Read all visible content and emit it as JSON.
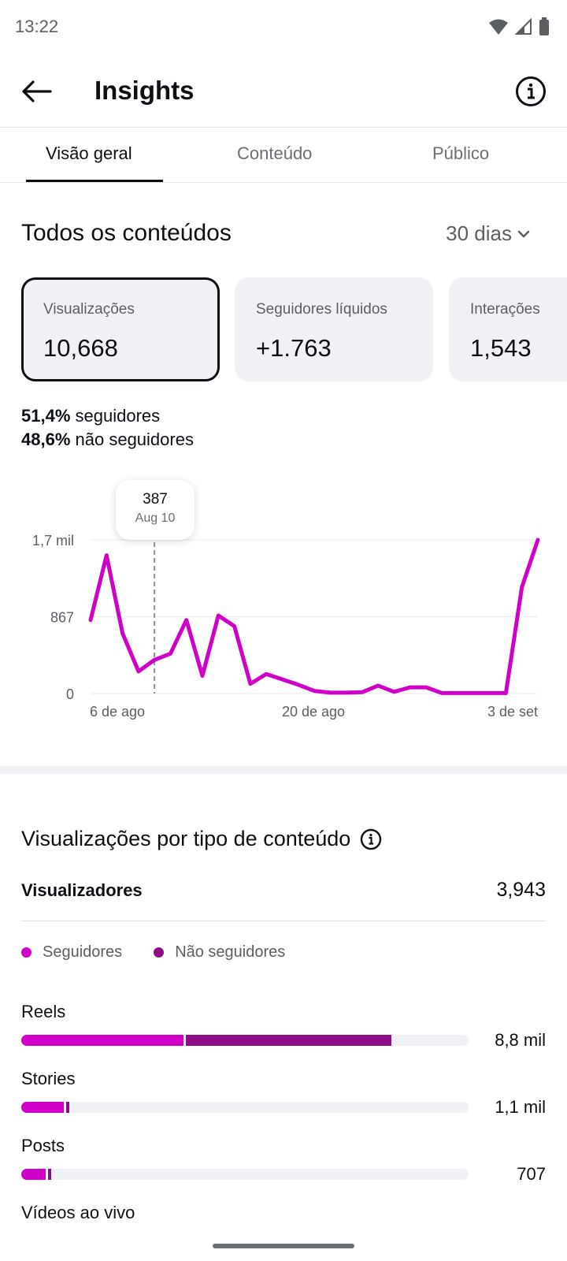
{
  "status_bar": {
    "time": "13:22"
  },
  "header": {
    "title": "Insights"
  },
  "tabs": [
    {
      "label": "Visão geral",
      "active": true
    },
    {
      "label": "Conteúdo",
      "active": false
    },
    {
      "label": "Público",
      "active": false
    }
  ],
  "section": {
    "title": "Todos os conteúdos",
    "range": "30 dias"
  },
  "metrics": [
    {
      "label": "Visualizações",
      "value": "10,668",
      "selected": true
    },
    {
      "label": "Seguidores líquidos",
      "value": "+1.763",
      "selected": false
    },
    {
      "label": "Interações",
      "value": "1,543",
      "selected": false
    }
  ],
  "ratio": {
    "followers_pct": "51,4%",
    "followers_text": "seguidores",
    "non_followers_pct": "48,6%",
    "non_followers_text": "não seguidores"
  },
  "tooltip": {
    "value": "387",
    "date": "Aug 10"
  },
  "chart_data": {
    "type": "line",
    "x_ticks": [
      "6 de ago",
      "20 de ago",
      "3 de set"
    ],
    "y_ticks": [
      "0",
      "867",
      "1,7 mil"
    ],
    "ylim": [
      0,
      1734
    ],
    "values": [
      830,
      1560,
      680,
      250,
      380,
      450,
      830,
      200,
      880,
      760,
      110,
      220,
      160,
      100,
      30,
      10,
      10,
      15,
      90,
      20,
      70,
      70,
      5,
      5,
      5,
      5,
      5,
      1200,
      1734
    ],
    "highlight_index": 4,
    "color": "#d100c9",
    "grid": true
  },
  "views_by_type": {
    "title": "Visualizações por tipo de conteúdo",
    "viewers_label": "Visualizadores",
    "viewers_value": "3,943",
    "legend": [
      {
        "label": "Seguidores",
        "color": "#d100c9"
      },
      {
        "label": "Não seguidores",
        "color": "#8e0d87"
      }
    ],
    "rows": [
      {
        "label": "Reels",
        "value": "8,8 mil",
        "followers_fraction": 0.362,
        "non_followers_fraction": 0.465
      },
      {
        "label": "Stories",
        "value": "1,1 mil",
        "followers_fraction": 0.095,
        "non_followers_fraction": 0.012
      },
      {
        "label": "Posts",
        "value": "707",
        "followers_fraction": 0.055,
        "non_followers_fraction": 0.012
      },
      {
        "label": "Vídeos ao vivo",
        "value": "",
        "followers_fraction": 0,
        "non_followers_fraction": 0
      }
    ]
  }
}
